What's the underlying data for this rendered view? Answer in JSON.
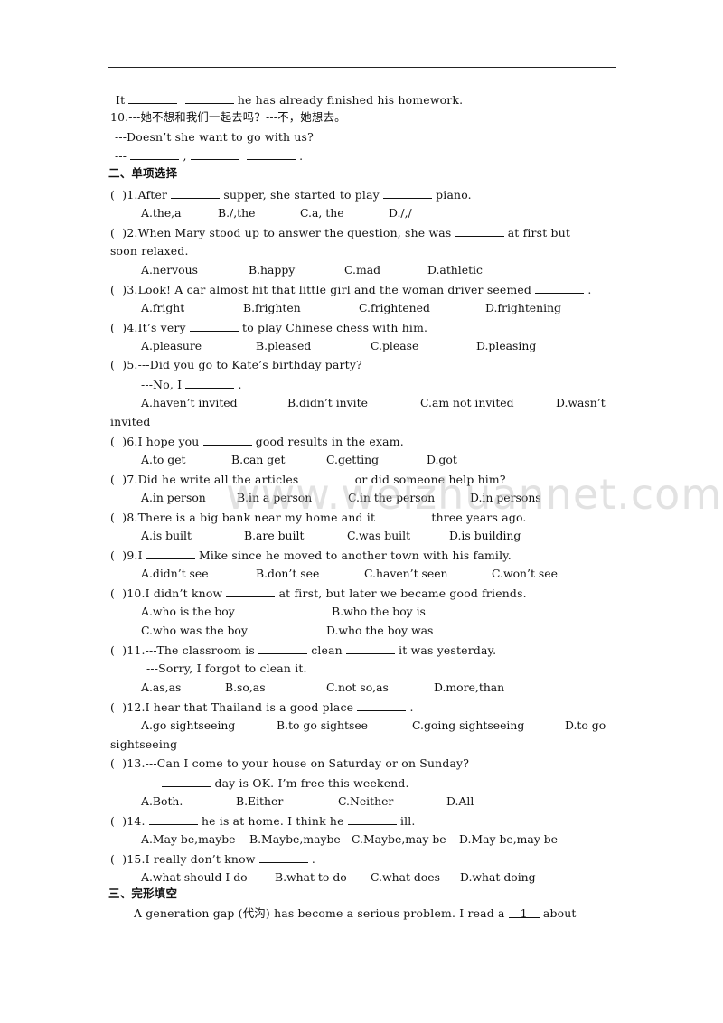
{
  "top_part": {
    "line_it": {
      "prefix": "It",
      "suffix": "he has already finished his homework."
    },
    "q10": {
      "chinese": "10.---她不想和我们一起去吗？---不，她想去。",
      "english": "---Doesn’t she want to go with us?",
      "answer_prefix": "---",
      "comma": ",",
      "period": "."
    }
  },
  "section2": {
    "title": "二、单项选择",
    "questions": [
      {
        "stem_a": "(  )1.After",
        "stem_b": "supper, she started to play",
        "stem_c": "piano.",
        "options": [
          "A.the,a",
          "B./,the",
          "C.a, the",
          "D./,/"
        ]
      },
      {
        "stem_a": "(  )2.When Mary stood up to answer the question, she was",
        "stem_b": "at first but",
        "cont": "soon relaxed.",
        "options": [
          "A.nervous",
          "B.happy",
          "C.mad",
          "D.athletic"
        ]
      },
      {
        "stem_a": "(  )3.Look! A car almost hit that little girl and the woman driver seemed",
        "stem_b": ".",
        "options": [
          "A.fright",
          "B.frighten",
          "C.frightened",
          "D.frightening"
        ]
      },
      {
        "stem_a": "(  )4.It’s very",
        "stem_b": "to play Chinese chess with him.",
        "options": [
          "A.pleasure",
          "B.pleased",
          "C.please",
          "D.pleasing"
        ]
      },
      {
        "stem_a": "(  )5.---Did you go to Kate’s birthday party?",
        "sub_a": "---No, I",
        "sub_b": ".",
        "options": [
          "A.haven’t invited",
          "B.didn’t invite",
          "C.am not invited",
          "D.wasn’t"
        ],
        "cont": "invited"
      },
      {
        "stem_a": "(  )6.I hope you",
        "stem_b": "good results in the exam.",
        "options": [
          "A.to get",
          "B.can get",
          "C.getting",
          "D.got"
        ]
      },
      {
        "stem_a": "(  )7.Did he write all the articles",
        "stem_b": "or did someone help him?",
        "options": [
          "A.in person",
          "B.in a person",
          "C.in the person",
          "D.in persons"
        ]
      },
      {
        "stem_a": "(  )8.There is a big bank near my home and it",
        "stem_b": "three years ago.",
        "options": [
          "A.is built",
          "B.are built",
          "C.was built",
          "D.is building"
        ]
      },
      {
        "stem_a": "(  )9.I",
        "stem_b": "Mike since he moved to another town with his family.",
        "options": [
          "A.didn’t see",
          "B.don’t see",
          "C.haven’t seen",
          "C.won’t see"
        ]
      },
      {
        "stem_a": "(  )10.I didn’t know",
        "stem_b": "at first, but later we became good friends.",
        "options": [
          "A.who is the boy",
          "B.who the boy is",
          "C.who was the boy",
          "D.who the boy was"
        ]
      },
      {
        "stem_a": "(  )11.---The classroom is",
        "stem_b": "clean",
        "stem_c": "it was yesterday.",
        "sub_a": "---Sorry, I forgot to clean it.",
        "options": [
          "A.as,as",
          "B.so,as",
          "C.not so,as",
          "D.more,than"
        ]
      },
      {
        "stem_a": "(  )12.I hear that Thailand is a good place",
        "stem_b": ".",
        "options": [
          "A.go sightseeing",
          "B.to go sightsee",
          "C.going sightseeing",
          "D.to go"
        ],
        "cont": "sightseeing"
      },
      {
        "stem_a": "(  )13.---Can I come to your house on Saturday or on Sunday?",
        "sub_a": "---",
        "sub_b": "day is OK. I’m free this weekend.",
        "options": [
          "A.Both.",
          "B.Either",
          "C.Neither",
          "D.All"
        ]
      },
      {
        "stem_a": "(  )14.",
        "stem_b": "he is at home. I think he",
        "stem_c": "ill.",
        "options": [
          "A.May be,maybe",
          "B.Maybe,maybe",
          "C.Maybe,may be",
          "D.May be,may be"
        ]
      },
      {
        "stem_a": "(  )15.I really don’t know",
        "stem_b": ".",
        "options": [
          "A.what should I do",
          "B.what to do",
          "C.what does",
          "D.what doing"
        ]
      }
    ]
  },
  "section3": {
    "title": "三、完形填空",
    "passage_a": "A generation gap (代沟) has become a serious problem. I read a",
    "blank_num": "1",
    "passage_b": "about"
  },
  "watermark": "www.weizhuannet.com"
}
